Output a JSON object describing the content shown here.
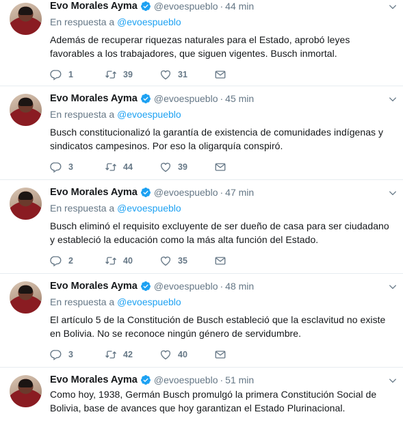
{
  "author": {
    "name": "Evo Morales Ayma",
    "handle": "@evoespueblo"
  },
  "reply_prefix": "En respuesta a",
  "reply_mention": "@evoespueblo",
  "dot": "·",
  "colors": {
    "accent": "#1da1f2",
    "muted": "#657786",
    "text": "#14171a",
    "divider": "#e6ecf0"
  },
  "icons": [
    "verified-badge-icon",
    "chevron-down-icon",
    "reply-icon",
    "retweet-icon",
    "like-icon",
    "message-icon"
  ],
  "tweets": [
    {
      "time": "44 min",
      "text": "Además de recuperar riquezas naturales para el Estado, aprobó leyes favorables a los trabajadores, que siguen vigentes. Busch inmortal.",
      "replies": "1",
      "retweets": "39",
      "likes": "31"
    },
    {
      "time": "45 min",
      "text": "Busch constitucionalizó la garantía de existencia de comunidades indígenas y sindicatos campesinos. Por eso la oligarquía conspiró.",
      "replies": "3",
      "retweets": "44",
      "likes": "39"
    },
    {
      "time": "47 min",
      "text": "Busch eliminó el requisito excluyente de ser dueño de casa para ser ciudadano y estableció la educación como la más alta función del Estado.",
      "replies": "2",
      "retweets": "40",
      "likes": "35"
    },
    {
      "time": "48 min",
      "text": "El artículo 5 de la Constitución de Busch estableció que la esclavitud no existe en Bolivia. No se reconoce ningún género de servidumbre.",
      "replies": "3",
      "retweets": "42",
      "likes": "40"
    },
    {
      "time": "51 min",
      "text": "Como hoy, 1938, Germán Busch promulgó la primera Constitución Social de Bolivia, base de avances que hoy garantizan el Estado Plurinacional."
    }
  ]
}
